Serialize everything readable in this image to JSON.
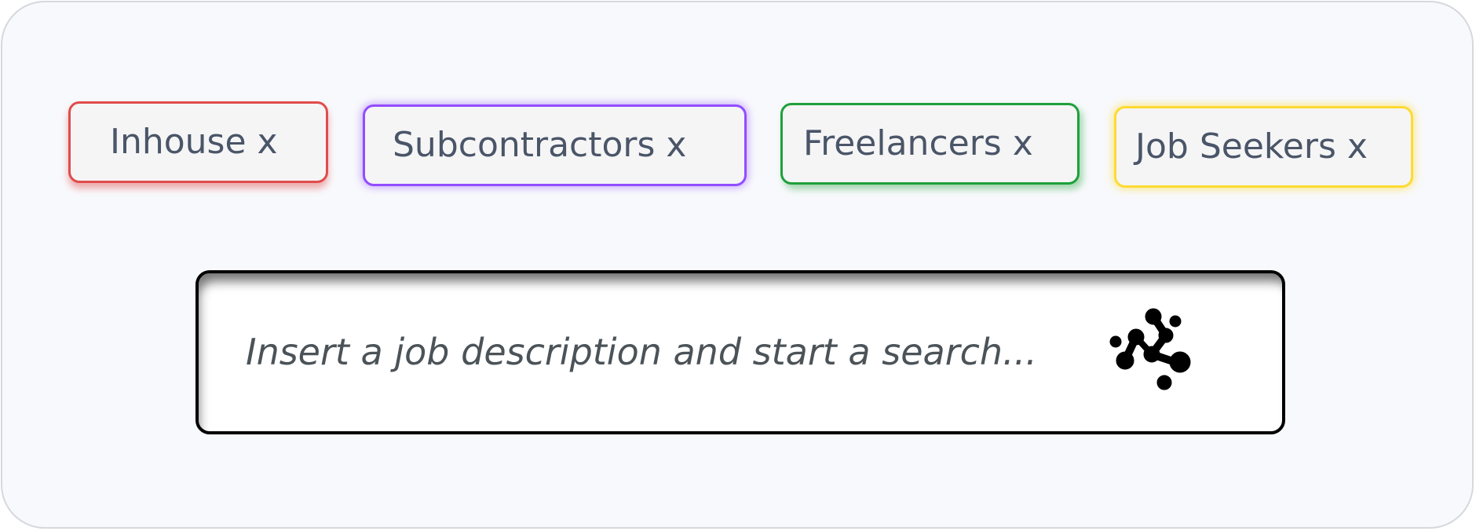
{
  "filters": [
    {
      "label": "Inhouse x",
      "color": "#e04c4c"
    },
    {
      "label": "Subcontractors x",
      "color": "#924dff"
    },
    {
      "label": "Freelancers x",
      "color": "#1fa03a"
    },
    {
      "label": "Job Seekers x",
      "color": "#fddb32"
    }
  ],
  "search": {
    "placeholder": "Insert a job description and start a search...",
    "value": "",
    "icon": "molecule-network-icon"
  }
}
